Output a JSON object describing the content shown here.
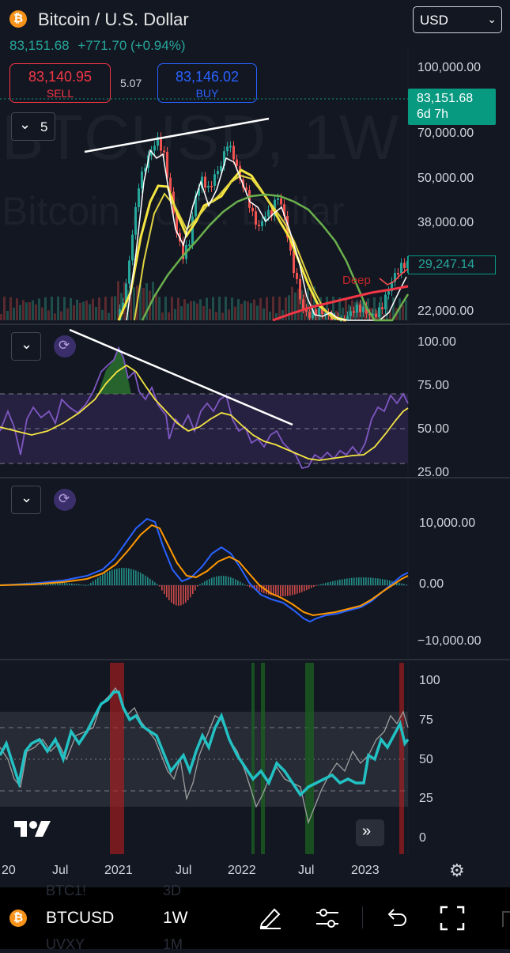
{
  "header": {
    "logo_glyph": "₿",
    "title": "Bitcoin / U.S. Dollar",
    "last_price": "83,151.68",
    "change": "+771.70 (+0.94%)",
    "currency": "USD"
  },
  "trade": {
    "sell_price": "83,140.95",
    "sell_label": "SELL",
    "spread": "5.07",
    "buy_price": "83,146.02",
    "buy_label": "BUY"
  },
  "watermark": {
    "symbol": "BTCUSD, 1W",
    "name": "Bitcoin / U.S. Dollar"
  },
  "main_pane": {
    "indicators_count": "5",
    "price_axis": [
      "100,000.00",
      "70,000.00",
      "50,000.00",
      "38,000.00",
      "22,000.00"
    ],
    "current_price": "83,151.68",
    "countdown": "6d 7h",
    "ma_value": "29,247.14",
    "overlay_text": "Deep"
  },
  "rsi_pane": {
    "axis": [
      "100.00",
      "75.00",
      "50.00",
      "25.00"
    ]
  },
  "macd_pane": {
    "axis": [
      "10,000.00",
      "0.00",
      "−10,000.00"
    ]
  },
  "osc_pane": {
    "axis": [
      "100",
      "75",
      "50",
      "25",
      "0"
    ]
  },
  "time_axis": [
    "20",
    "Jul",
    "2021",
    "Jul",
    "2022",
    "Jul",
    "2023"
  ],
  "bottom": {
    "symbol": "BTCUSD",
    "interval": "1W",
    "ghost_top_left": "BTC1!",
    "ghost_top_right": "3D",
    "ghost_bottom_left": "UVXY",
    "ghost_bottom_right": "1M"
  },
  "colors": {
    "background": "#131722",
    "up": "#26a69a",
    "down": "#ef5350",
    "sell": "#f23645",
    "buy": "#2962ff",
    "rsi": "#7e57c2",
    "rsi_ma": "#f5e642",
    "macd": "#2962ff",
    "signal": "#ff9800",
    "osc_main": "#22c1c3"
  },
  "icons": [
    "bitcoin-icon",
    "chevron-down-icon",
    "collapse-chevron-icon",
    "refresh-icon",
    "tradingview-logo-icon",
    "double-chevron-right-icon",
    "settings-icon",
    "pen-icon",
    "sliders-icon",
    "undo-icon",
    "fullscreen-icon"
  ]
}
